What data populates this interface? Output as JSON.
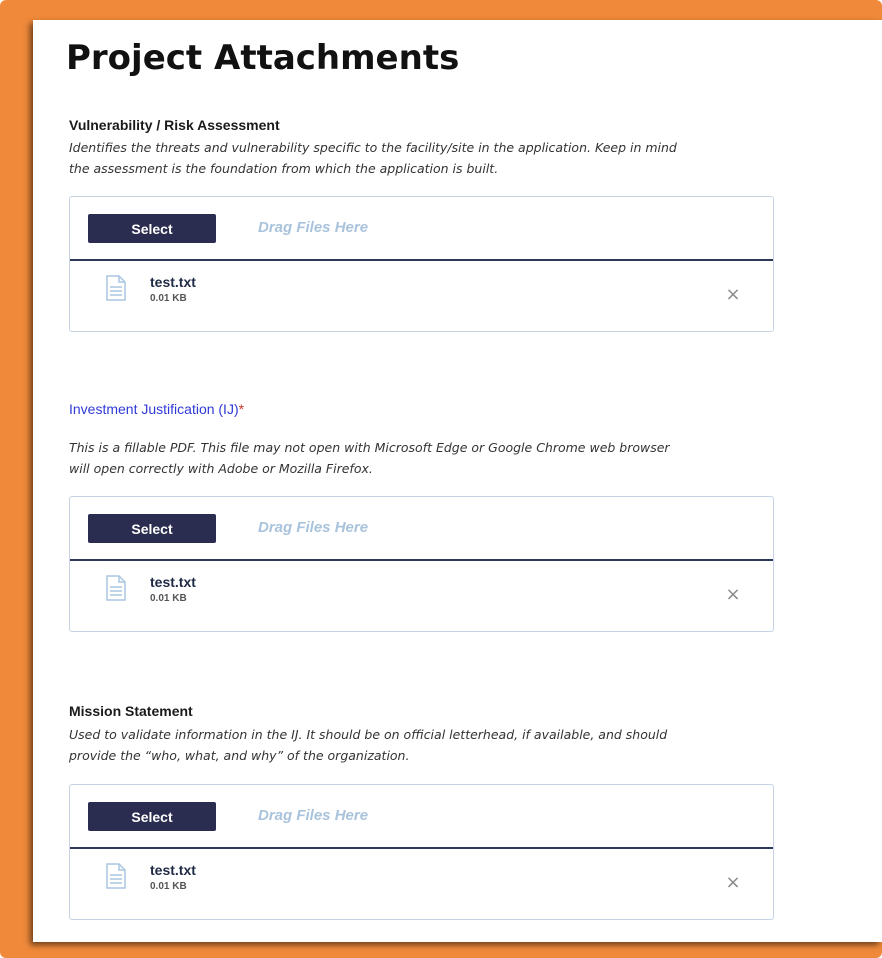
{
  "page": {
    "title": "Project Attachments"
  },
  "sections": [
    {
      "title": "Vulnerability / Risk Assessment",
      "required": "",
      "description_lines": [
        "Identifies the threats and vulnerability specific to the facility/site in the application. Keep in mind",
        "the assessment is the foundation from which the application is built."
      ],
      "select_label": "Select",
      "drop_hint": "Drag Files Here",
      "file": {
        "name": "test.txt",
        "size": "0.01 KB",
        "remove_icon": "close-icon"
      }
    },
    {
      "title": "Investment Justification (IJ)",
      "required": "*",
      "description_lines": [
        "This is a fillable PDF. This file may not open with Microsoft Edge or Google Chrome web browser",
        "will open correctly with Adobe or Mozilla Firefox."
      ],
      "select_label": "Select",
      "drop_hint": "Drag Files Here",
      "file": {
        "name": "test.txt",
        "size": "0.01 KB",
        "remove_icon": "close-icon"
      }
    },
    {
      "title": "Mission Statement",
      "required": "",
      "description_lines": [
        "Used to validate information in the IJ. It should be on official letterhead, if available, and should",
        "provide the “who, what, and why” of the organization."
      ],
      "select_label": "Select",
      "drop_hint": "Drag Files Here",
      "file": {
        "name": "test.txt",
        "size": "0.01 KB",
        "remove_icon": "close-icon"
      }
    }
  ],
  "colors": {
    "frame": "#f08a3a",
    "select_button": "#2b2d50",
    "link_title": "#2f3ad6",
    "required_mark": "#d0342c",
    "drop_hint": "#a9c3dc"
  },
  "remove_glyph": "×"
}
